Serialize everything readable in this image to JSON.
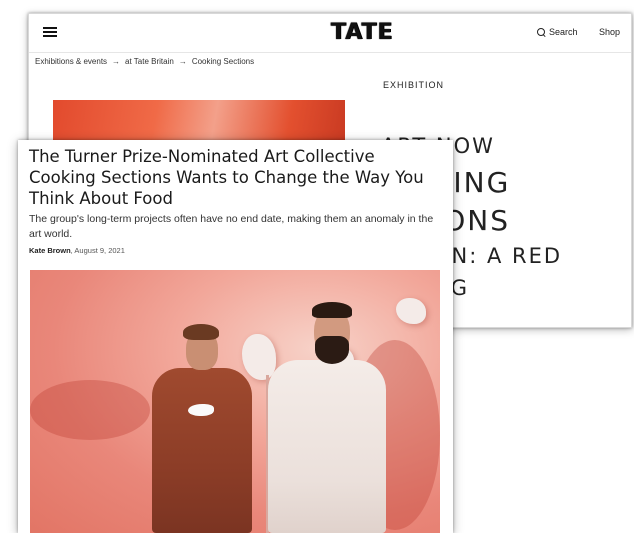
{
  "tate": {
    "logo": "TATE",
    "search_label": "Search",
    "shop_label": "Shop",
    "breadcrumb": [
      "Exhibitions & events",
      "at Tate Britain",
      "Cooking Sections"
    ],
    "breadcrumb_separator": "→",
    "exhibition_label": "EXHIBITION",
    "title_lines": [
      "ART NOW",
      "KING",
      "IONS",
      "ON: A RED",
      "NG"
    ]
  },
  "article": {
    "headline": "The Turner Prize-Nominated Art Collective Cooking Sections Wants to Change the Way You Think About Food",
    "dek": "The group's long-term projects often have no end date, making them an anomaly in the art world.",
    "author": "Kate Brown",
    "date": ", August 9, 2021"
  },
  "colors": {
    "hero_red": "#e24a2d",
    "photo_pink": "#f2a79a"
  }
}
